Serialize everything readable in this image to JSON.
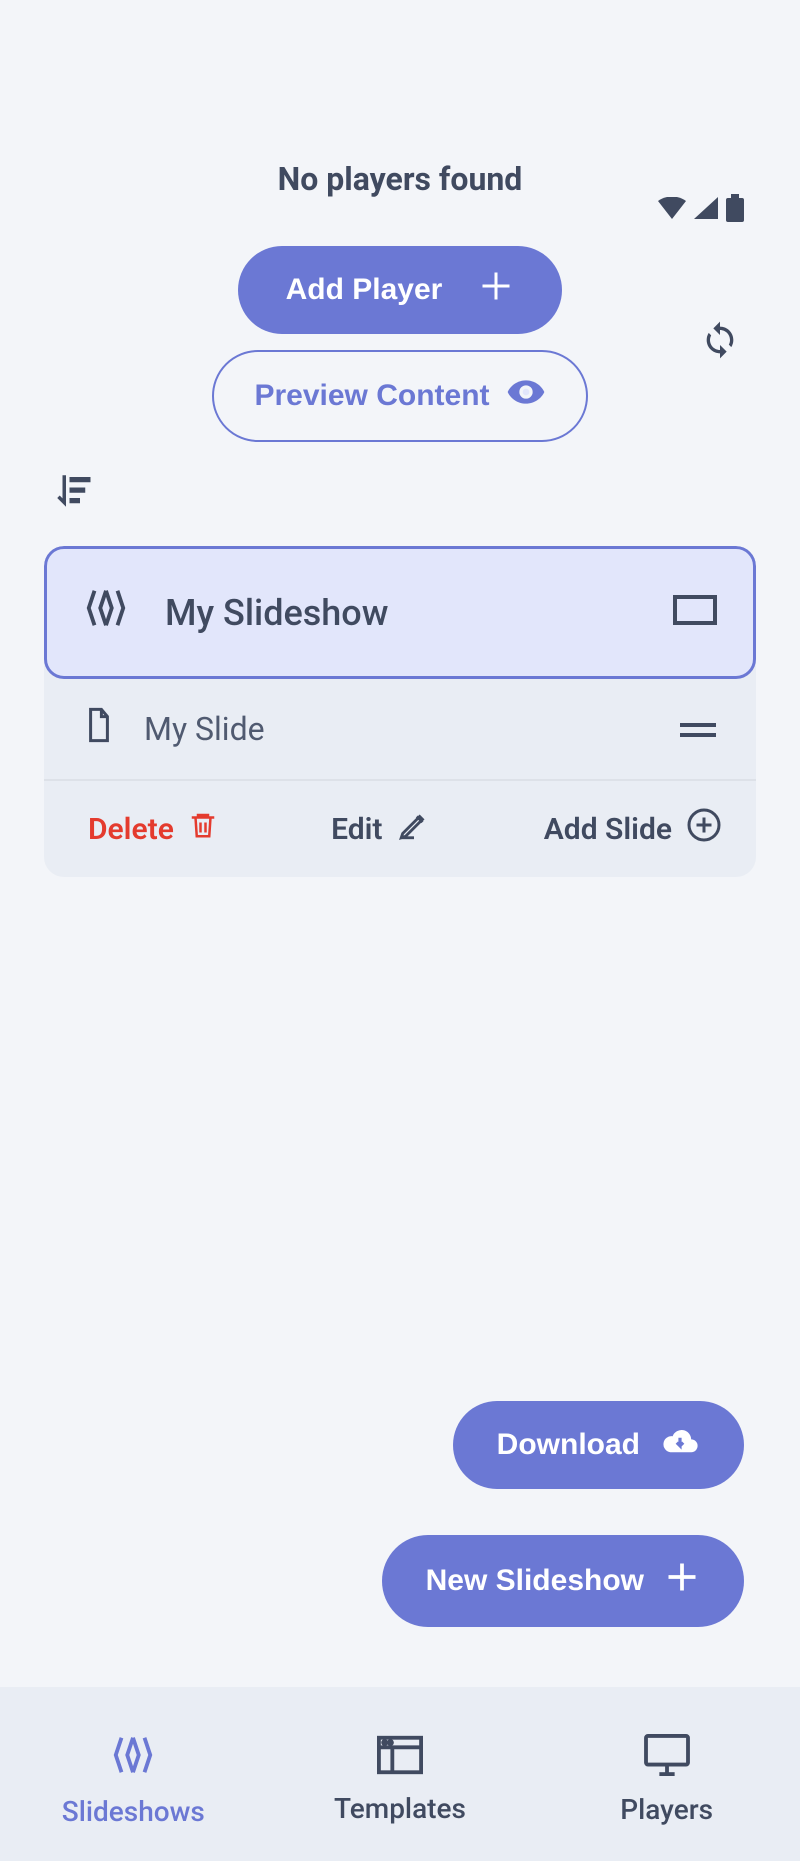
{
  "header": {
    "no_players": "No players found",
    "add_player": "Add Player",
    "preview_content": "Preview Content"
  },
  "slideshow": {
    "title": "My Slideshow",
    "slide": "My Slide",
    "actions": {
      "delete": "Delete",
      "edit": "Edit",
      "add_slide": "Add Slide"
    }
  },
  "fabs": {
    "download": "Download",
    "new_slideshow": "New Slideshow"
  },
  "tabs": {
    "slideshows": "Slideshows",
    "templates": "Templates",
    "players": "Players"
  },
  "colors": {
    "accent": "#6b78d4",
    "danger": "#e43b2e",
    "text": "#404a60"
  }
}
